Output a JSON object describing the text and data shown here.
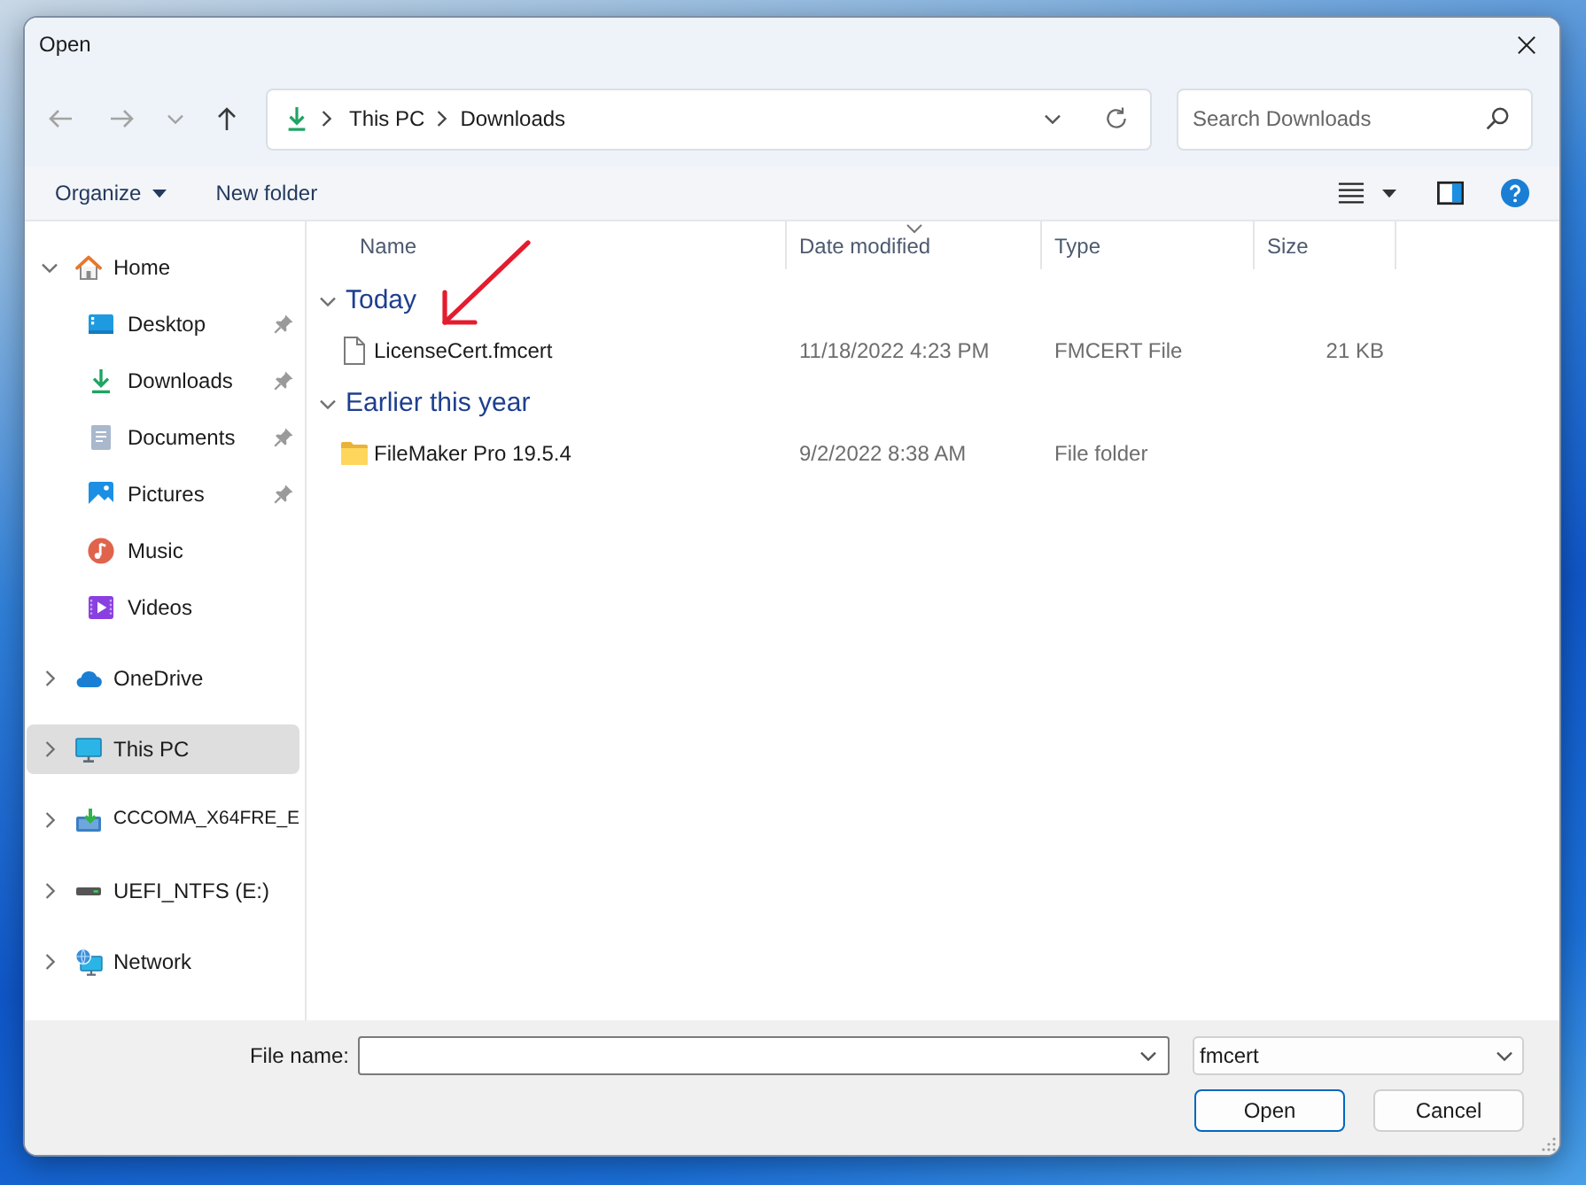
{
  "window": {
    "title": "Open"
  },
  "navigation": {
    "buttons": [
      {
        "kind": "back",
        "disabled": true
      },
      {
        "kind": "forward",
        "disabled": true
      },
      {
        "kind": "recent",
        "disabled": true
      },
      {
        "kind": "up",
        "disabled": false
      }
    ],
    "path": [
      {
        "label": "This PC"
      },
      {
        "label": "Downloads"
      }
    ],
    "search": {
      "placeholder": "Search Downloads"
    }
  },
  "toolbar": {
    "items": [
      {
        "kind": "menu",
        "label": "Organize"
      },
      {
        "kind": "button",
        "label": "New folder"
      }
    ]
  },
  "sidebar": {
    "items": [
      {
        "label": "Home",
        "kind": "home",
        "expanded": true,
        "selected": false,
        "children": [
          {
            "label": "Desktop",
            "kind": "desktop",
            "pinned": true,
            "selected": false
          },
          {
            "label": "Downloads",
            "kind": "downloads",
            "pinned": true,
            "selected": false
          },
          {
            "label": "Documents",
            "kind": "documents",
            "pinned": true,
            "selected": false
          },
          {
            "label": "Pictures",
            "kind": "pictures",
            "pinned": true,
            "selected": false
          },
          {
            "label": "Music",
            "kind": "music",
            "pinned": false,
            "selected": false
          },
          {
            "label": "Videos",
            "kind": "videos",
            "pinned": false,
            "selected": false
          }
        ]
      },
      {
        "label": "OneDrive",
        "kind": "cloud",
        "expanded": false,
        "selected": false
      },
      {
        "label": "This PC",
        "kind": "computer",
        "expanded": false,
        "selected": true
      },
      {
        "label": "CCCOMA_X64FRE_E",
        "kind": "install-drive",
        "expanded": false,
        "selected": false
      },
      {
        "label": "UEFI_NTFS (E:)",
        "kind": "drive",
        "expanded": false,
        "selected": false
      },
      {
        "label": "Network",
        "kind": "network",
        "expanded": false,
        "selected": false
      }
    ]
  },
  "columns": [
    {
      "label": "Name",
      "sorted": false
    },
    {
      "label": "Date modified",
      "sorted": true
    },
    {
      "label": "Type",
      "sorted": false
    },
    {
      "label": "Size",
      "sorted": false
    }
  ],
  "groups": [
    {
      "label": "Today",
      "expanded": true,
      "items": [
        {
          "kind": "file",
          "name": "LicenseCert.fmcert",
          "date_modified": "11/18/2022 4:23 PM",
          "type": "FMCERT File",
          "size": "21 KB"
        }
      ]
    },
    {
      "label": "Earlier this year",
      "expanded": true,
      "items": [
        {
          "kind": "folder",
          "name": "FileMaker Pro 19.5.4",
          "date_modified": "9/2/2022 8:38 AM",
          "type": "File folder"
        }
      ]
    }
  ],
  "footer": {
    "file_name": {
      "label": "File name:"
    },
    "file_type": {
      "value": "fmcert"
    },
    "buttons": [
      {
        "label": "Open",
        "default": true
      },
      {
        "label": "Cancel",
        "default": false
      }
    ]
  }
}
